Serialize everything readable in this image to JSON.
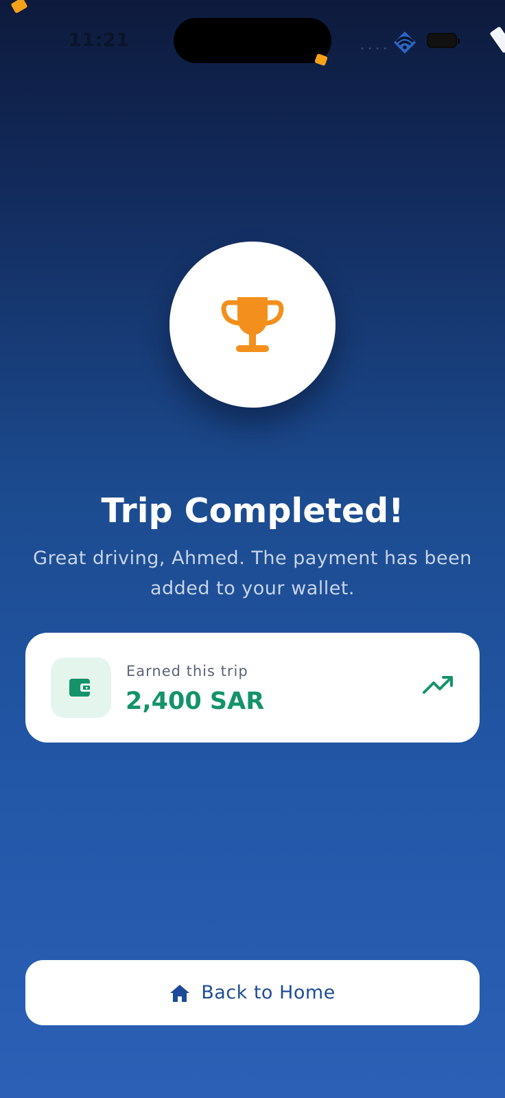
{
  "status_bar": {
    "time": "11:21"
  },
  "icons": {
    "trophy": "trophy-icon",
    "wallet": "wallet-icon",
    "trend": "trending-up-icon",
    "home": "home-icon"
  },
  "colors": {
    "accent_orange": "#f38f1c",
    "earn_green": "#14936a",
    "button_text": "#1e4b98"
  },
  "main": {
    "title": "Trip Completed!",
    "subtitle_line1": "Great driving, Ahmed. The payment has been",
    "subtitle_line2": "added to your wallet."
  },
  "earnings": {
    "label": "Earned this trip",
    "value": "2,400 SAR"
  },
  "actions": {
    "home_label": "Back to Home"
  }
}
